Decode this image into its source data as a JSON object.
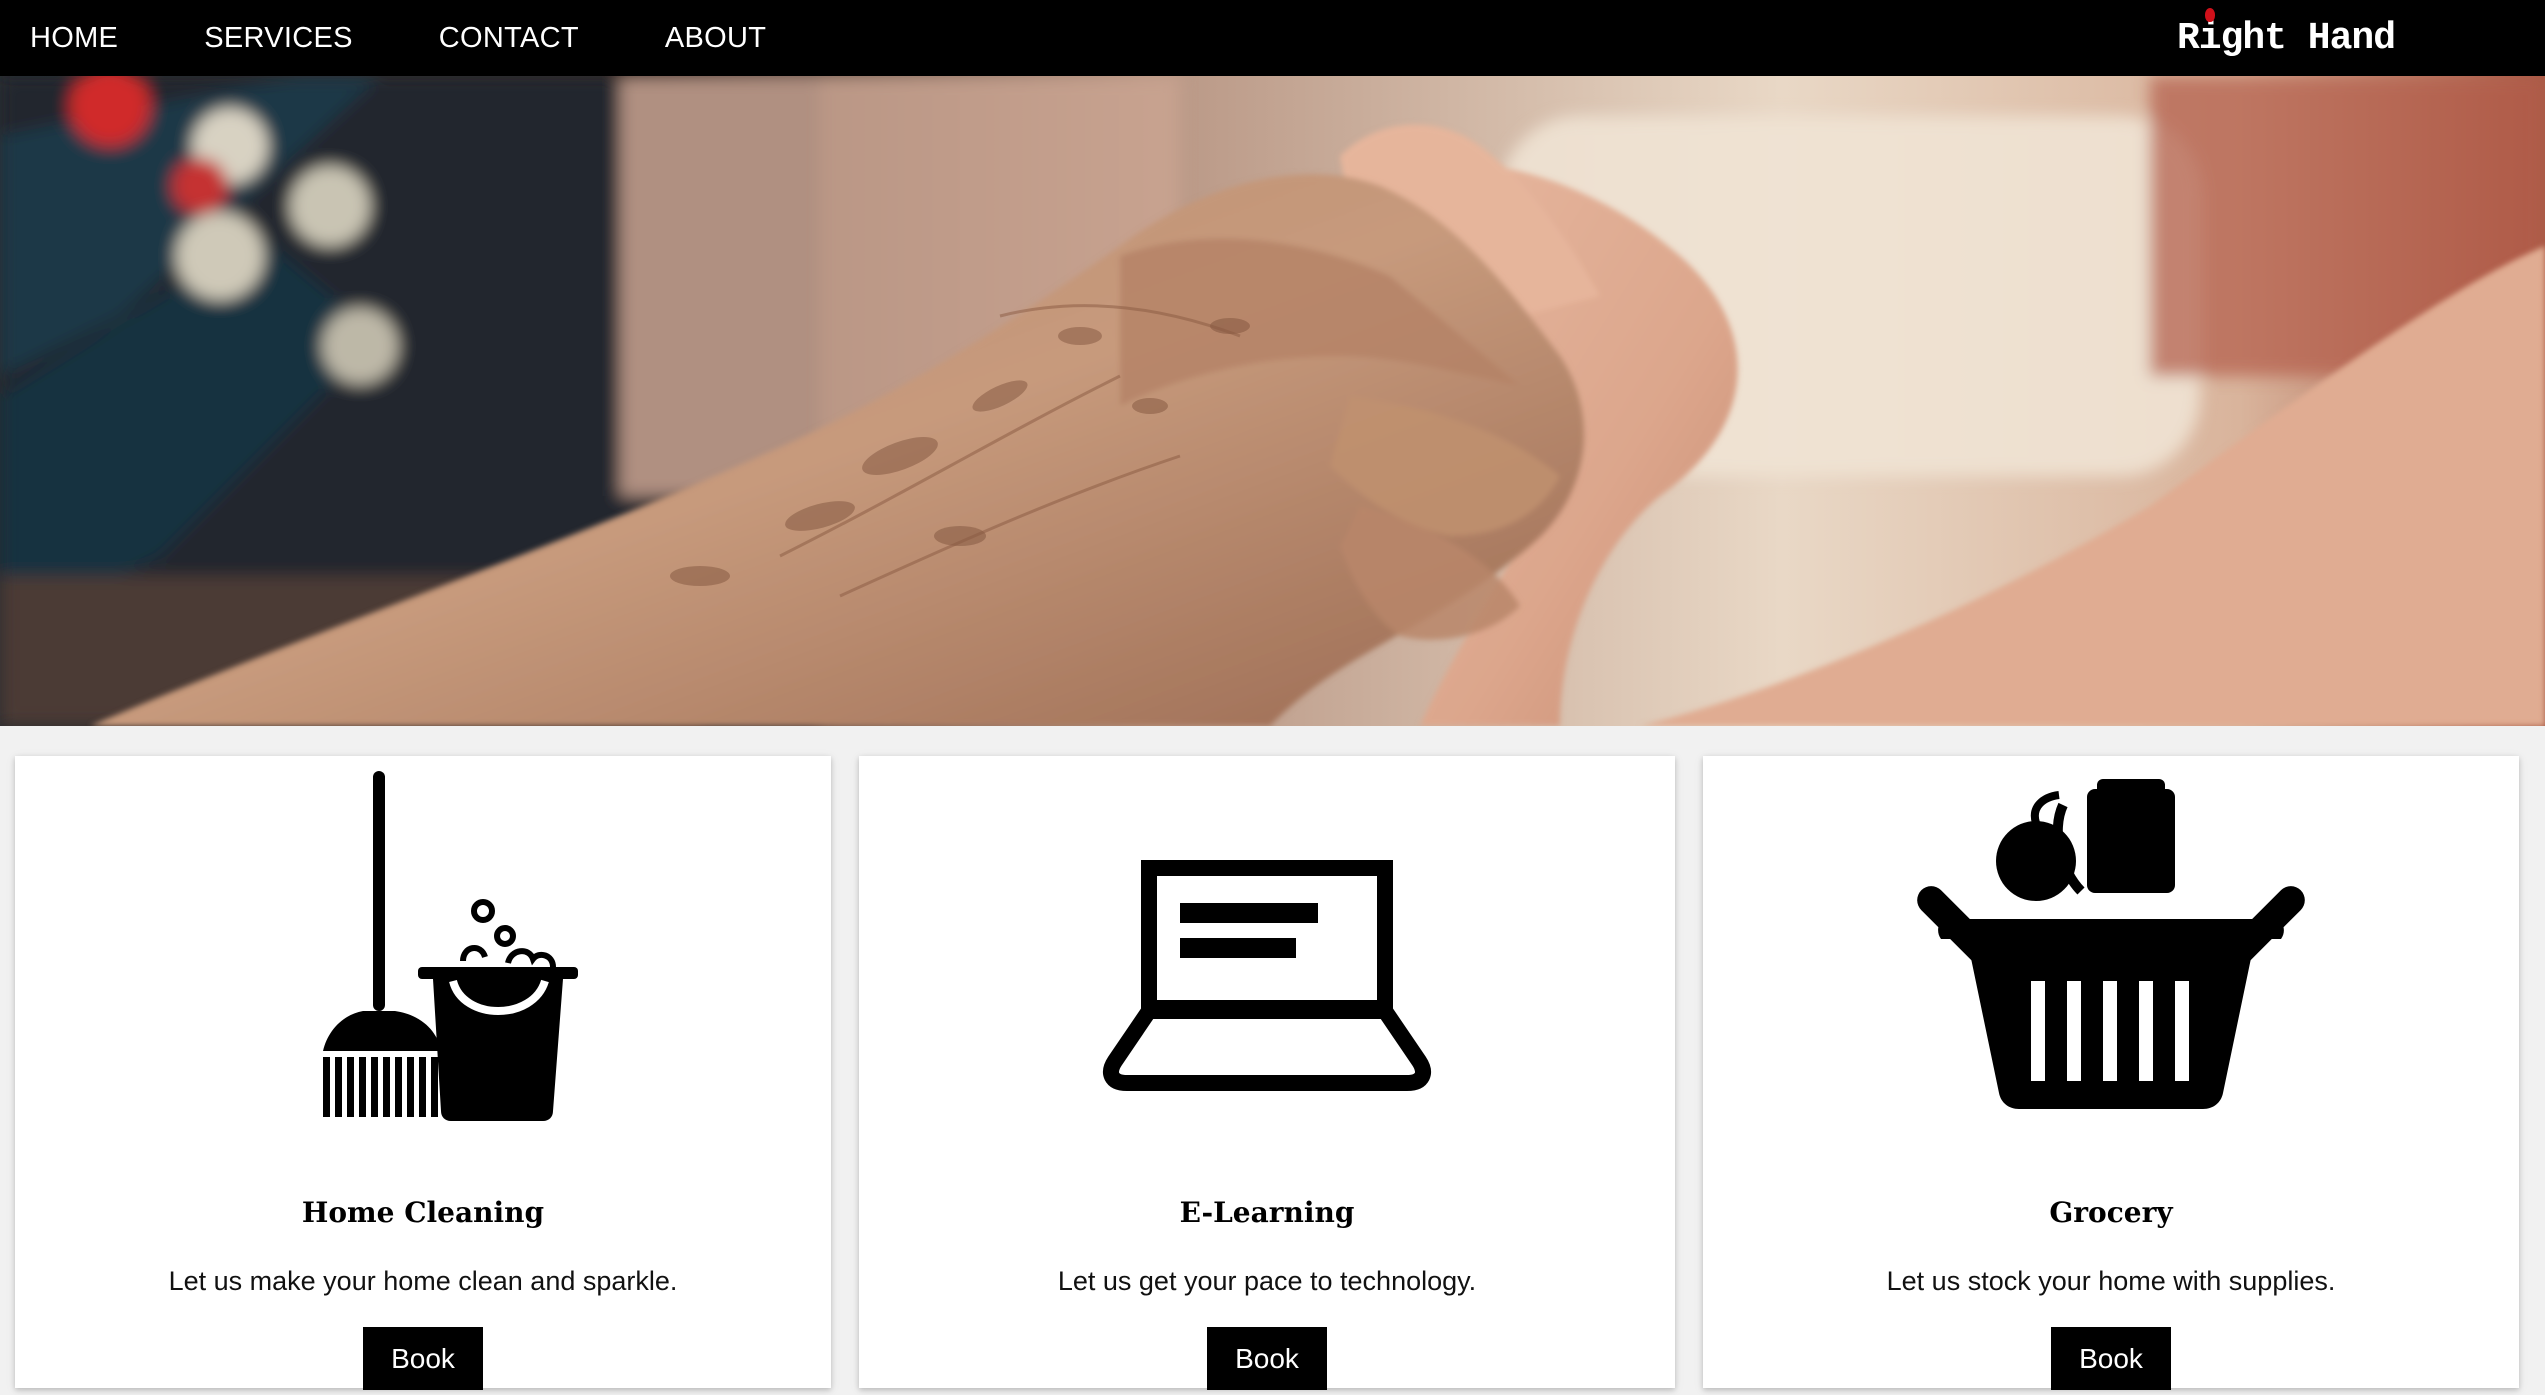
{
  "nav": {
    "links": [
      {
        "label": "HOME"
      },
      {
        "label": "SERVICES"
      },
      {
        "label": "CONTACT"
      },
      {
        "label": "ABOUT"
      }
    ],
    "brand": {
      "before": "R",
      "i": "i",
      "after": "ght Hand",
      "accent_color": "#d0101a"
    }
  },
  "hero": {
    "image": "photo of an elderly hand holding a younger hand"
  },
  "cards": [
    {
      "icon": "mop-bucket-icon",
      "title": "Home Cleaning",
      "description": "Let us make your home clean and sparkle.",
      "button": "Book"
    },
    {
      "icon": "laptop-icon",
      "title": "E-Learning",
      "description": "Let us get your pace to technology.",
      "button": "Book"
    },
    {
      "icon": "grocery-basket-icon",
      "title": "Grocery",
      "description": "Let us stock your home with supplies.",
      "button": "Book"
    }
  ]
}
